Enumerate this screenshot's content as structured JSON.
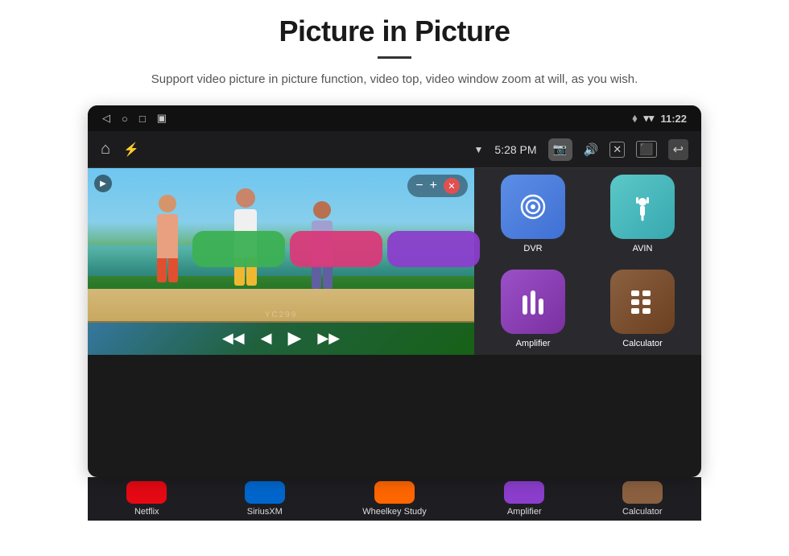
{
  "header": {
    "title": "Picture in Picture",
    "subtitle": "Support video picture in picture function, video top, video window zoom at will, as you wish."
  },
  "status_bar": {
    "left_icons": [
      "◁",
      "○",
      "□",
      "▣"
    ],
    "wifi_icon": "▼",
    "location_icon": "📍",
    "signal_icon": "▾▾",
    "time": "11:22"
  },
  "nav_bar": {
    "home_icon": "⌂",
    "usb_icon": "⚡",
    "wifi_status": "▼",
    "time": "5:28 PM",
    "camera_icon": "📷",
    "volume_icon": "🔊",
    "close_icon": "✕",
    "pip_icon": "⬛",
    "back_icon": "↩"
  },
  "apps": {
    "top_row_colors": [
      "#3CB054",
      "#D93A7A",
      "#8B3ECC"
    ],
    "grid": [
      {
        "id": "dvr",
        "label": "DVR",
        "icon": "📡",
        "bg": "dvr-icon-bg",
        "symbol": "◎"
      },
      {
        "id": "avin",
        "label": "AVIN",
        "icon": "🔌",
        "bg": "avin-icon-bg",
        "symbol": "⑁"
      },
      {
        "id": "amplifier",
        "label": "Amplifier",
        "icon": "🎛",
        "bg": "amplifier-icon-bg",
        "symbol": "⫶"
      },
      {
        "id": "calculator",
        "label": "Calculator",
        "icon": "🧮",
        "bg": "calculator-icon-bg",
        "symbol": "⊞"
      }
    ]
  },
  "bottom_apps": [
    {
      "label": "Netflix",
      "color": "#E50914"
    },
    {
      "label": "SiriusXM",
      "color": "#0066CC"
    },
    {
      "label": "Wheelkey Study",
      "color": "#FF6600"
    },
    {
      "label": "Amplifier",
      "color": "#8B3ECC"
    },
    {
      "label": "Calculator",
      "color": "#8B6040"
    }
  ],
  "video": {
    "pip_minus": "−",
    "pip_plus": "+",
    "pip_close": "✕",
    "record_icon": "▶",
    "rewind": "◀◀",
    "prev": "◀",
    "play": "▶",
    "next": "▶▶",
    "watermark": "YC299"
  }
}
